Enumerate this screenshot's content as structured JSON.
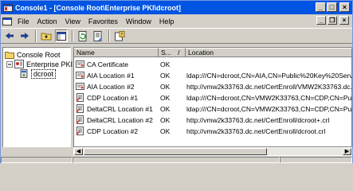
{
  "window": {
    "title": "Console1 - [Console Root\\Enterprise PKI\\dcroot]"
  },
  "window_controls": {
    "minimize": "_",
    "maximize": "□",
    "close": "×"
  },
  "mdi_controls": {
    "minimize": "_",
    "restore": "❐",
    "close": "×"
  },
  "menu": [
    {
      "label": "File"
    },
    {
      "label": "Action"
    },
    {
      "label": "View"
    },
    {
      "label": "Favorites"
    },
    {
      "label": "Window"
    },
    {
      "label": "Help"
    }
  ],
  "tree": {
    "root": "Console Root",
    "child": "Enterprise PKI",
    "leaf": "dcroot"
  },
  "columns": {
    "name": "Name",
    "status": "S...",
    "sort_indicator": "/",
    "location": "Location"
  },
  "rows": [
    {
      "name": "CA Certificate",
      "status": "OK",
      "location": "",
      "icon": "certificate-icon"
    },
    {
      "name": "AIA Location #1",
      "status": "OK",
      "location": "ldap:///CN=dcroot,CN=AIA,CN=Public%20Key%20Servi",
      "icon": "certificate-icon"
    },
    {
      "name": "AIA Location #2",
      "status": "OK",
      "location": "http://vmw2k33763.dc.net/CertEnroll/VMW2K33763.dc.n",
      "icon": "certificate-icon"
    },
    {
      "name": "CDP Location #1",
      "status": "OK",
      "location": "ldap:///CN=dcroot,CN=VMW2K33763,CN=CDP,CN=Publi",
      "icon": "crl-icon"
    },
    {
      "name": "DeltaCRL Location #1",
      "status": "OK",
      "location": "ldap:///CN=dcroot,CN=VMW2K33763,CN=CDP,CN=Publi",
      "icon": "crl-icon"
    },
    {
      "name": "DeltaCRL Location #2",
      "status": "OK",
      "location": "http://vmw2k33763.dc.net/CertEnroll/dcroot+.crl",
      "icon": "crl-icon"
    },
    {
      "name": "CDP Location #2",
      "status": "OK",
      "location": "http://vmw2k33763.dc.net/CertEnroll/dcroot.crl",
      "icon": "crl-icon"
    }
  ],
  "scrollbar": {
    "left_arrow": "◀",
    "right_arrow": "▶"
  }
}
